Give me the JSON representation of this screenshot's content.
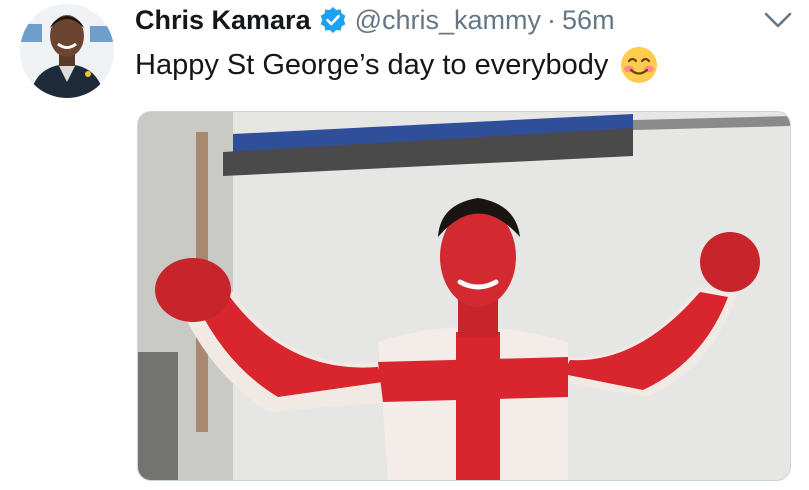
{
  "tweet": {
    "author_name": "Chris Kamara",
    "handle": "@chris_kammy",
    "separator": "·",
    "time": "56m",
    "text": "Happy St George’s day to everybody",
    "emoji": "smiling-face-icon",
    "verified": "verified-badge-icon"
  },
  "colors": {
    "text": "#14171a",
    "secondary": "#657786",
    "verified": "#1da1f2",
    "border": "#ccd6dd"
  }
}
